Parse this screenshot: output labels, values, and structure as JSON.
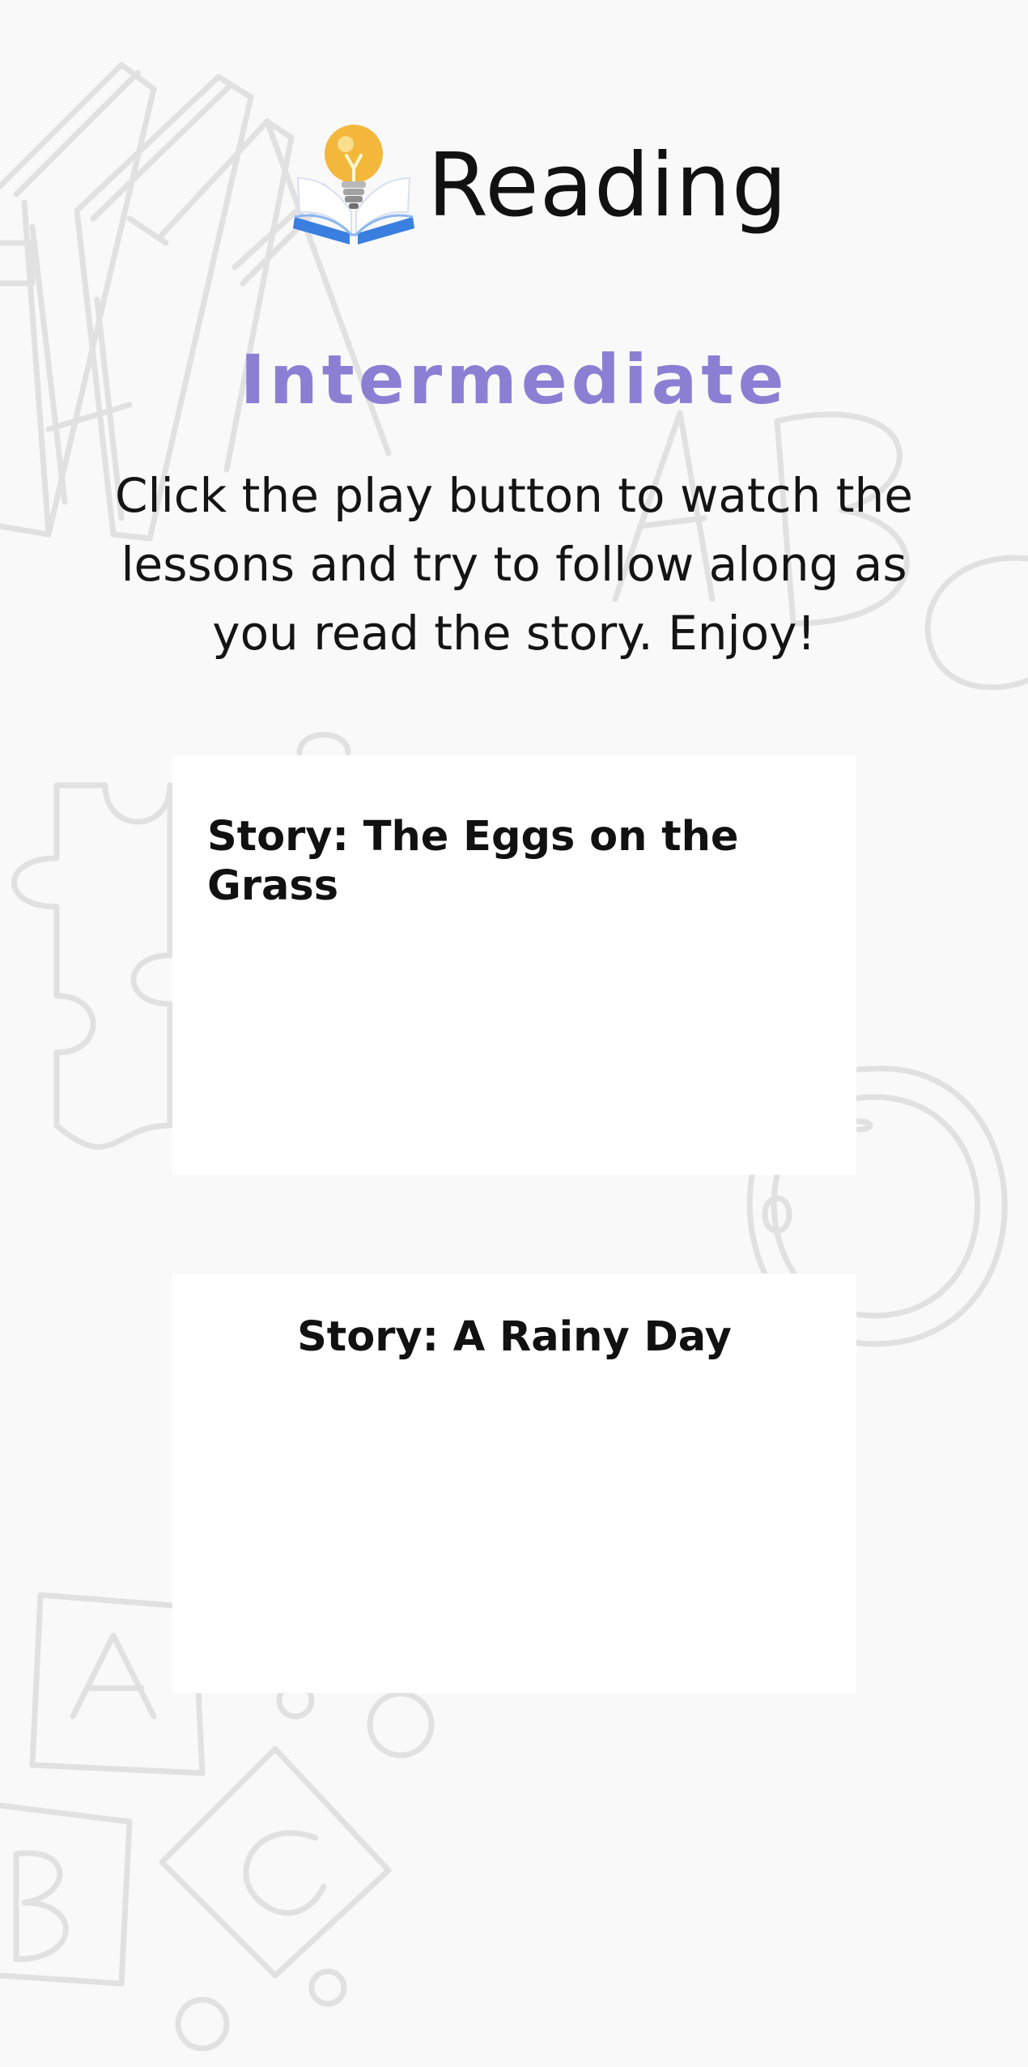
{
  "header": {
    "title": "Reading",
    "logo_icon": "book-lightbulb-icon"
  },
  "level": {
    "label": "Intermediate"
  },
  "instructions": {
    "text": "Click the play button to watch the lessons and try to follow along as you read the story. Enjoy!"
  },
  "stories": [
    {
      "title": "Story: The Eggs on the Grass"
    },
    {
      "title": "Story: A Rainy Day"
    }
  ],
  "background": {
    "doodle_letters": [
      "A",
      "B",
      "A",
      "B",
      "C"
    ]
  },
  "colors": {
    "background": "#f9f9f9",
    "accent": "#8b7fd4",
    "card": "#ffffff",
    "text": "#111111",
    "doodle": "#e1e1e1"
  }
}
